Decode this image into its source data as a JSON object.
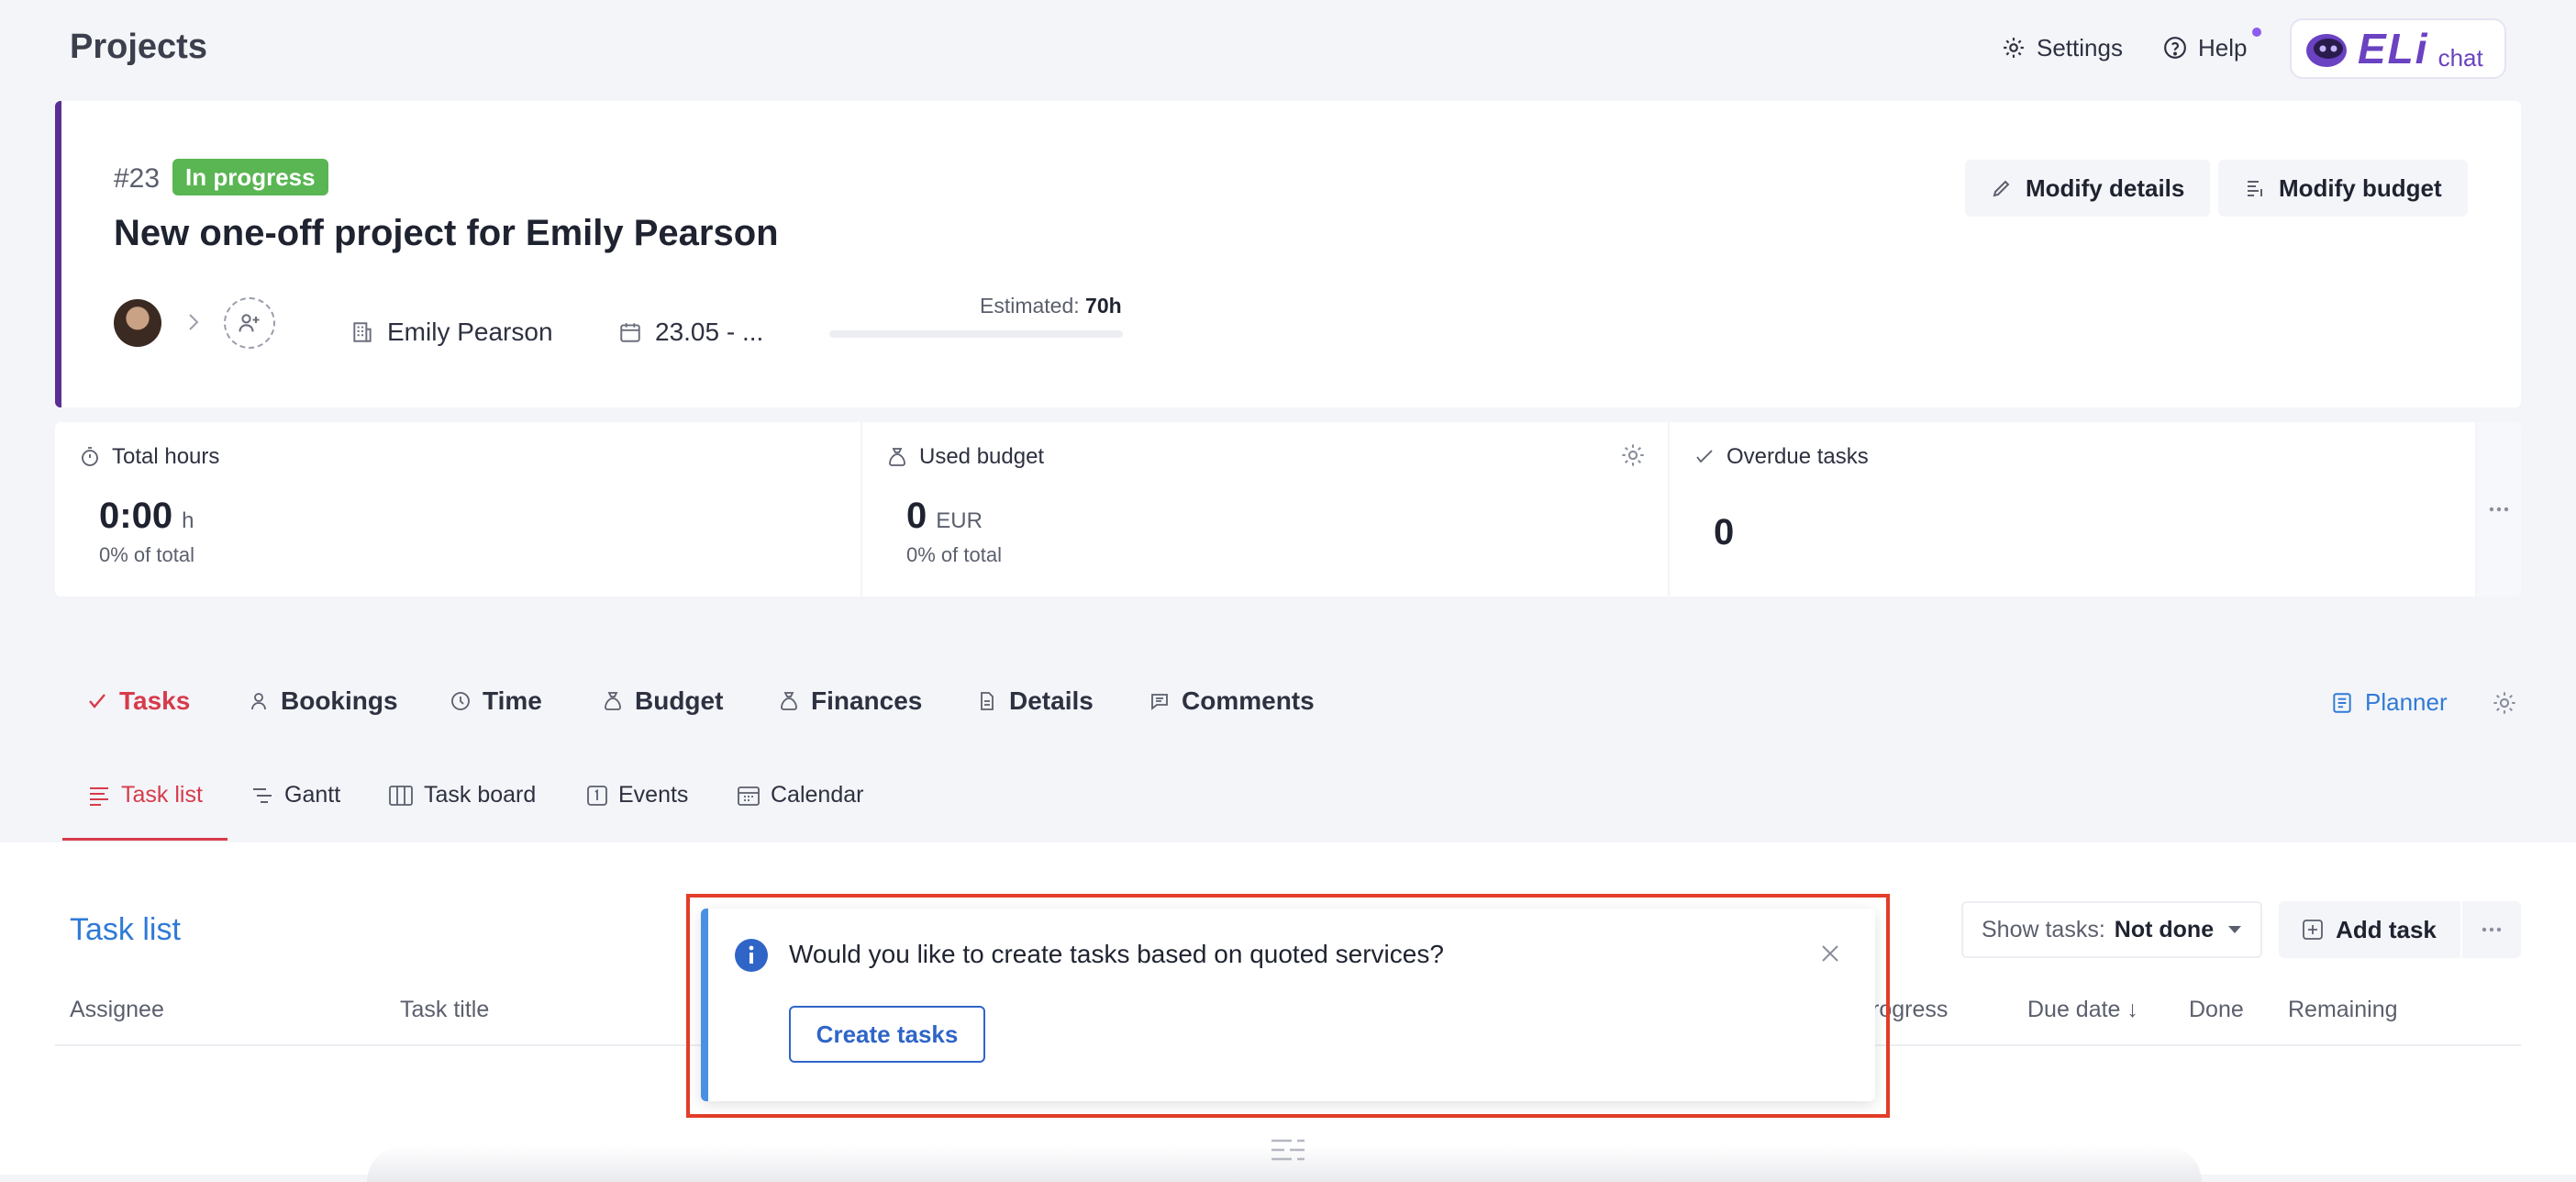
{
  "header": {
    "title": "Projects",
    "settings_label": "Settings",
    "help_label": "Help",
    "logo_word": "ELi",
    "logo_sub": "chat"
  },
  "project": {
    "id": "#23",
    "status": "In progress",
    "name": "New one-off project for Emily Pearson",
    "modify_details": "Modify details",
    "modify_budget": "Modify budget",
    "client": "Emily Pearson",
    "dates": "23.05 - ...",
    "estimated_label": "Estimated:",
    "estimated_value": "70h",
    "estimated_progress": 0
  },
  "stats": {
    "total_hours": {
      "label": "Total hours",
      "value": "0:00",
      "unit": "h",
      "pct": "0%",
      "sub": "of total"
    },
    "used_budget": {
      "label": "Used budget",
      "value": "0",
      "unit": "EUR",
      "pct": "0%",
      "sub": "of total"
    },
    "overdue_tasks": {
      "label": "Overdue tasks",
      "value": "0"
    }
  },
  "tabs": {
    "tasks": "Tasks",
    "bookings": "Bookings",
    "time": "Time",
    "budget": "Budget",
    "finances": "Finances",
    "details": "Details",
    "comments": "Comments",
    "planner": "Planner"
  },
  "subtabs": {
    "task_list": "Task list",
    "gantt": "Gantt",
    "task_board": "Task board",
    "events": "Events",
    "calendar": "Calendar"
  },
  "tasklist": {
    "title": "Task list",
    "show_tasks_label": "Show tasks:",
    "show_tasks_value": "Not done",
    "add_task": "Add task",
    "columns": [
      "Assignee",
      "Task title",
      "rogress",
      "Due date ↓",
      "Done",
      "Remaining"
    ]
  },
  "notification": {
    "message": "Would you like to create tasks based on quoted services?",
    "button": "Create tasks"
  },
  "colors": {
    "accent_red": "#d73b4b",
    "accent_blue": "#2f7ad6",
    "status_green": "#5ab553",
    "brand_purple": "#5a2e93",
    "highlight_red": "#e23d28"
  }
}
